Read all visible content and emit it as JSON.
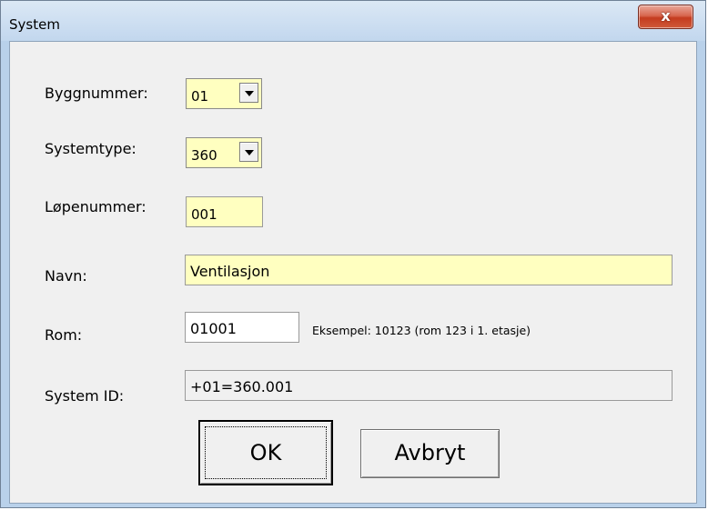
{
  "window": {
    "title": "System",
    "close_glyph": "x"
  },
  "form": {
    "byggnummer": {
      "label": "Byggnummer:",
      "value": "01"
    },
    "systemtype": {
      "label": "Systemtype:",
      "value": "360"
    },
    "lopenummer": {
      "label": "Løpenummer:",
      "value": "001"
    },
    "navn": {
      "label": "Navn:",
      "value": "Ventilasjon"
    },
    "rom": {
      "label": "Rom:",
      "value": "01001",
      "hint": "Eksempel: 10123 (rom 123 i 1. etasje)"
    },
    "system_id": {
      "label": "System ID:",
      "value": "+01=360.001"
    }
  },
  "buttons": {
    "ok": "OK",
    "cancel": "Avbryt"
  },
  "colors": {
    "required_field": "#ffffc0",
    "readonly_field": "#f0f0f0",
    "client_bg": "#f0f0f0",
    "frame": "#b9d1ea"
  }
}
